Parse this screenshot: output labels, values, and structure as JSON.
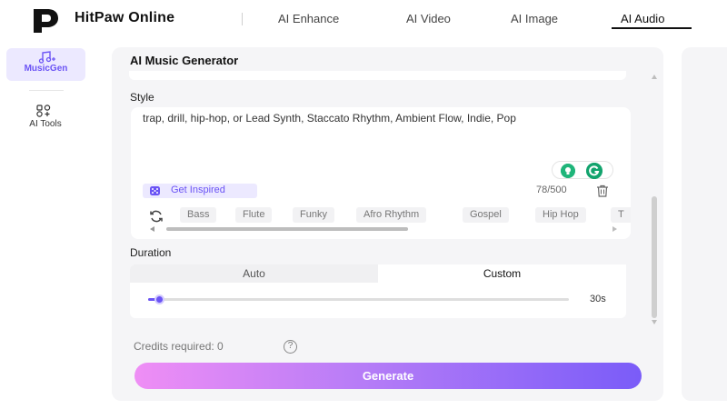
{
  "header": {
    "brand": "HitPaw Online",
    "nav": [
      {
        "label": "AI Enhance"
      },
      {
        "label": "AI Video"
      },
      {
        "label": "AI Image"
      },
      {
        "label": "AI Audio",
        "active": true
      }
    ]
  },
  "sidebar": {
    "items": [
      {
        "label": "MusicGen",
        "icon": "music-note-icon",
        "active": true
      },
      {
        "label": "AI Tools",
        "icon": "tools-grid-icon",
        "active": false
      }
    ]
  },
  "main": {
    "title": "AI Music Generator",
    "style": {
      "label": "Style",
      "value": "trap, drill, hip-hop, or Lead Synth, Staccato Rhythm, Ambient Flow, Indie, Pop",
      "inspire_label": "Get Inspired",
      "counter": "78/500",
      "tags": [
        "Bass",
        "Flute",
        "Funky",
        "Afro Rhythm",
        "Gospel",
        "Hip Hop",
        "T"
      ]
    },
    "duration": {
      "label": "Duration",
      "options": [
        "Auto",
        "Custom"
      ],
      "selected": "Custom",
      "value_label": "30s",
      "slider_fraction": 0.02
    },
    "credits_label": "Credits required: 0",
    "help_glyph": "?",
    "generate_label": "Generate"
  },
  "colors": {
    "accent": "#6b54f5",
    "accent_light": "#ece9ff",
    "panel_bg": "#f5f5f7",
    "grammarly_green": "#12a36d",
    "generate_gradient": [
      "#ef8ef5",
      "#7a5cf8"
    ]
  }
}
